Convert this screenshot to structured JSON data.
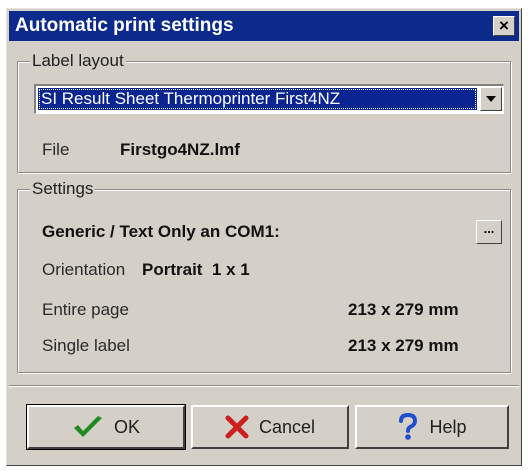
{
  "window": {
    "title": "Automatic print settings",
    "close_glyph": "×"
  },
  "label_layout": {
    "group_title": "Label layout",
    "selected_layout": "SI Result Sheet Thermoprinter First4NZ",
    "file_label": "File",
    "file_value": "Firstgo4NZ.lmf"
  },
  "settings": {
    "group_title": "Settings",
    "printer": "Generic / Text Only an COM1:",
    "browse_glyph": "...",
    "orientation_label": "Orientation",
    "orientation_value": "Portrait  1 x 1",
    "entire_page_label": "Entire page",
    "entire_page_value": "213 x 279 mm",
    "single_label_label": "Single label",
    "single_label_value": "213 x 279 mm"
  },
  "buttons": {
    "ok": "OK",
    "cancel": "Cancel",
    "help": "Help"
  },
  "colors": {
    "titlebar": "#0c2a8c",
    "selection": "#0a2491",
    "dialog_face": "#d4d0c8",
    "ok_check": "#1f8a1f",
    "cancel_x": "#cc1f1f",
    "help_q": "#1f4fd1"
  },
  "icons": {
    "ok": "checkmark-icon",
    "cancel": "red-x-icon",
    "help": "question-mark-icon",
    "dropdown": "dropdown-arrow-icon",
    "close": "close-icon"
  }
}
